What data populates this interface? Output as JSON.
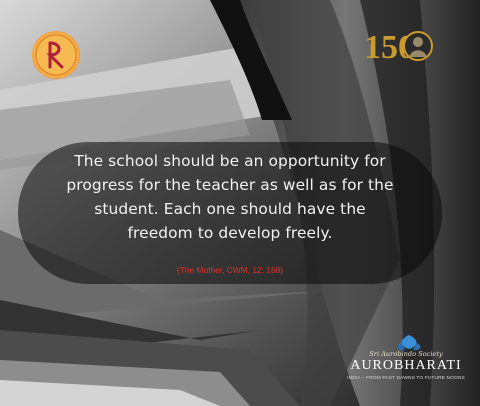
{
  "quote": {
    "lines": [
      "The school should be an opportunity for",
      "progress for the teacher as well as for the",
      "student. Each one should have the",
      "freedom to develop freely."
    ],
    "source": "(The Mother, CWM, 12; 168)"
  },
  "logos": {
    "left_icon": "circular-orange-emblem-icon",
    "right_text": "150",
    "right_icon": "portrait-medallion-icon"
  },
  "branding": {
    "tagline": "Sri Aurobindo Society",
    "name": "AUROBHARATI",
    "subline": "INDIA – FROM PAST DAWNS TO FUTURE NOONS",
    "icon": "aurobharati-emblem-icon"
  },
  "colors": {
    "source_text": "#e0322a",
    "gold": "#c99a2e"
  }
}
